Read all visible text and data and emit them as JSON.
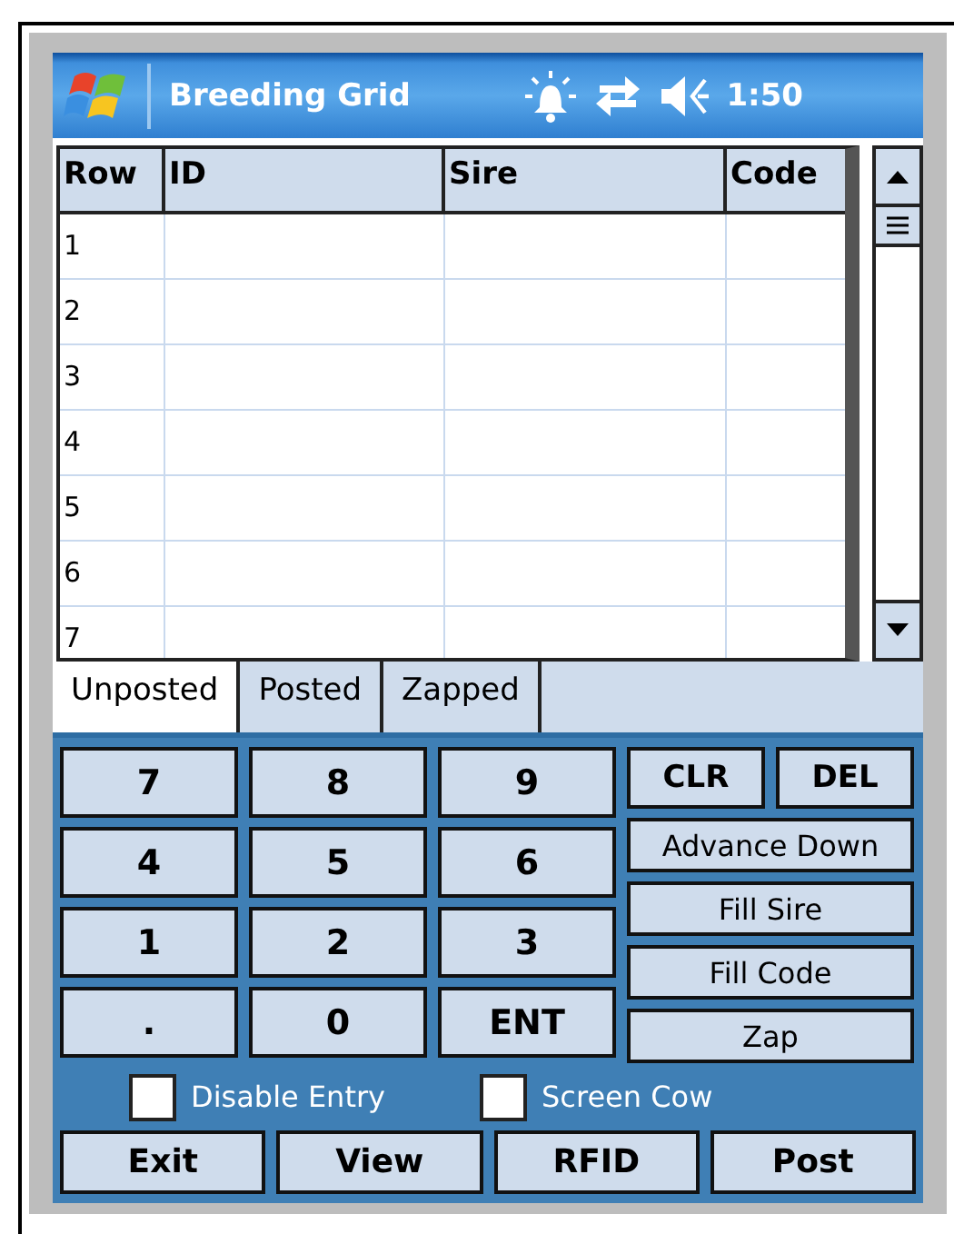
{
  "title_bar": {
    "title": "Breeding Grid",
    "time": "1:50"
  },
  "table": {
    "columns": [
      "Row",
      "ID",
      "Sire",
      "Code"
    ],
    "rows": [
      {
        "row": "1"
      },
      {
        "row": "2"
      },
      {
        "row": "3"
      },
      {
        "row": "4"
      },
      {
        "row": "5"
      },
      {
        "row": "6"
      },
      {
        "row": "7"
      }
    ]
  },
  "tabs": [
    {
      "label": "Unposted",
      "selected": true
    },
    {
      "label": "Posted",
      "selected": false
    },
    {
      "label": "Zapped",
      "selected": false
    }
  ],
  "keypad": {
    "keys": [
      "7",
      "8",
      "9",
      "4",
      "5",
      "6",
      "1",
      "2",
      "3",
      ".",
      "0",
      "ENT"
    ],
    "small_keys": [
      "CLR",
      "DEL"
    ],
    "actions": [
      "Advance Down",
      "Fill Sire",
      "Fill Code",
      "Zap"
    ]
  },
  "checkboxes": [
    {
      "label": "Disable Entry",
      "checked": false
    },
    {
      "label": "Screen Cow",
      "checked": false
    }
  ],
  "buttons": [
    "Exit",
    "View",
    "RFID",
    "Post"
  ]
}
